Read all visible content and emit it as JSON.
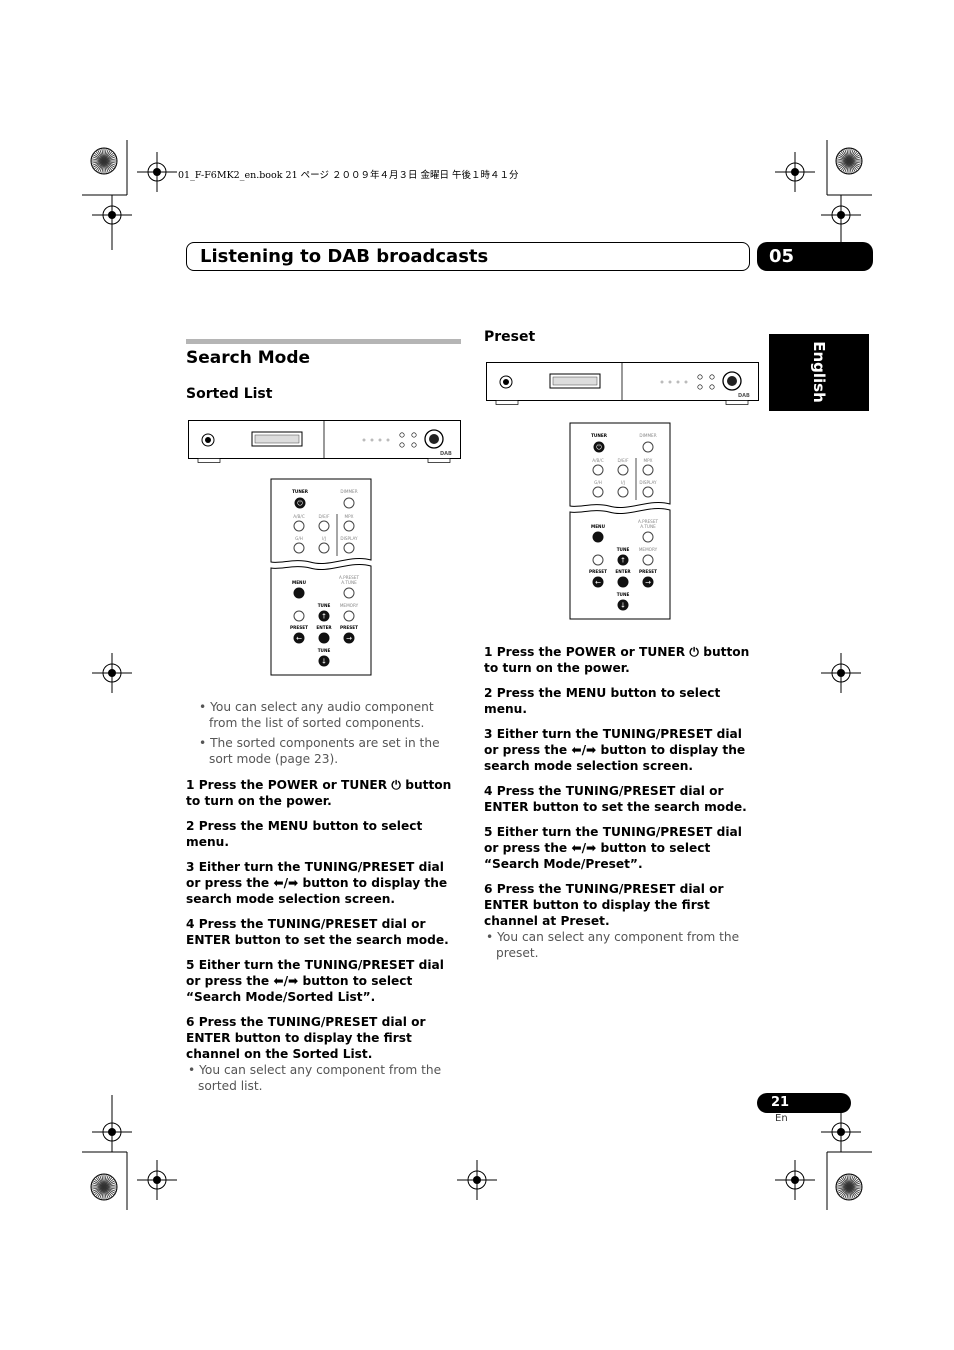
{
  "print_line": "01_F-F6MK2_en.book  21 ページ  ２００９年４月３日  金曜日  午後１時４１分",
  "header": {
    "title": "Listening to DAB broadcasts",
    "chapter": "05"
  },
  "side_tab": "English",
  "left": {
    "section_title": "Search Mode",
    "subsection_title": "Sorted List",
    "bullets": [
      "You can select any audio component from the list of sorted components.",
      "The sorted components are set in the sort mode (page 23)."
    ],
    "steps": [
      "1    Press the POWER or TUNER ⏻ button to turn on the power.",
      "2    Press the MENU button to select menu.",
      "3    Either turn the TUNING/PRESET dial or press the ⬅/➡ button to display the search mode selection screen.",
      "4    Press the TUNING/PRESET dial or ENTER button to set the search mode.",
      "5    Either turn the TUNING/PRESET dial or press the ⬅/➡ button to select “Search Mode/Sorted List”.",
      "6    Press the TUNING/PRESET dial or ENTER button to display the first channel on the Sorted List."
    ],
    "final_note": "You can select any component from the sorted list."
  },
  "right": {
    "subsection_title": "Preset",
    "steps": [
      "1    Press the POWER or TUNER ⏻ button to turn on the power.",
      "2    Press the MENU button to select menu.",
      "3    Either turn the TUNING/PRESET dial or press the ⬅/➡ button to display the search mode selection screen.",
      "4    Press the TUNING/PRESET dial or ENTER button to set the search mode.",
      "5    Either turn the TUNING/PRESET dial or press the ⬅/➡ button to select “Search Mode/Preset”.",
      "6    Press the TUNING/PRESET dial or ENTER button to display the first channel at Preset."
    ],
    "final_note": "You can select any component from the preset."
  },
  "remote_labels": {
    "tuner": "TUNER",
    "dimmer": "DIMMER",
    "abc": "A/B/C",
    "def": "D/E/F",
    "mpx": "MPX",
    "gh": "G/H",
    "ij": "I/J",
    "display": "DISPLAY",
    "menu": "MENU",
    "apreset": "A.PRESET A.TUNE",
    "tune": "TUNE",
    "memory": "MEMORY",
    "preset": "PRESET",
    "enter": "ENTER"
  },
  "device_labels": {
    "dab": "DAB"
  },
  "footer": {
    "page_number": "21",
    "lang": "En"
  }
}
